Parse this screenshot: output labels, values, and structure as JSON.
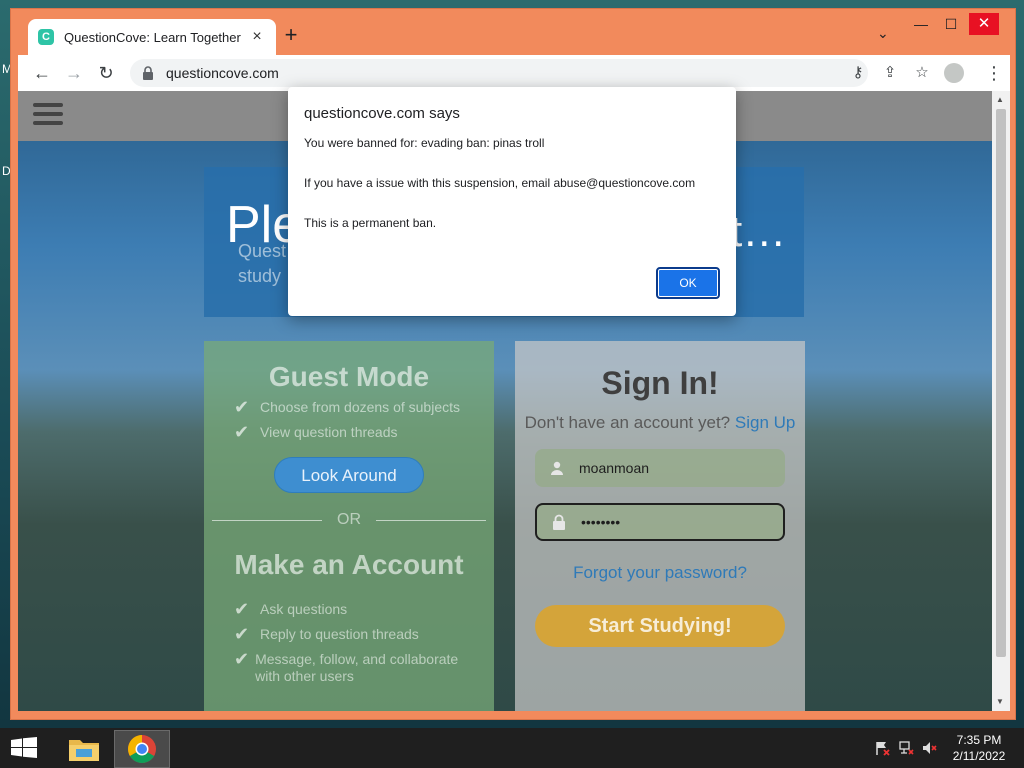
{
  "desktop": {
    "edge_letter_1": "M",
    "edge_letter_2": "D"
  },
  "browser": {
    "tab_favicon": "C",
    "tab_title": "QuestionCove: Learn Together",
    "tab_close": "×",
    "new_tab": "+",
    "tab_search": "⌄",
    "window_controls": {
      "minimize": "—",
      "maximize": "☐",
      "close": "✕"
    },
    "nav": {
      "back": "←",
      "forward": "→",
      "reload": "↻"
    },
    "url": "questioncove.com",
    "toolbar_icons": {
      "key": "⚷",
      "share": "⇪",
      "bookmark": "☆",
      "menu": "⋮"
    }
  },
  "page": {
    "hero_title": "Ple",
    "hero_ellipsis": "t…",
    "hero_sub_line1": "Quest",
    "hero_sub_line2": "study",
    "guest": {
      "heading": "Guest Mode",
      "items": [
        "Choose from dozens of subjects",
        "View question threads"
      ],
      "look_around": "Look Around",
      "or": "OR",
      "make_account": "Make an Account",
      "account_items": [
        "Ask questions",
        "Reply to question threads",
        "Message, follow, and collaborate with other users"
      ]
    },
    "signin": {
      "title": "Sign In!",
      "prompt": "Don't have an account yet?",
      "signup": "Sign Up",
      "username": "moanmoan",
      "password": "••••••••",
      "forgot": "Forgot your password?",
      "start": "Start Studying!"
    }
  },
  "dialog": {
    "title": "questioncove.com says",
    "line1": "You were banned for: evading ban: pinas troll",
    "line2": "If you have a issue with this suspension, email abuse@questioncove.com",
    "line3": "This is a permanent ban.",
    "ok": "OK"
  },
  "taskbar": {
    "time": "7:35 PM",
    "date": "2/11/2022"
  },
  "colors": {
    "window_frame": "#f28a5c",
    "dialog_ok": "#1a73e8",
    "start_button": "#d4a43a",
    "link": "#2f7ab8"
  }
}
